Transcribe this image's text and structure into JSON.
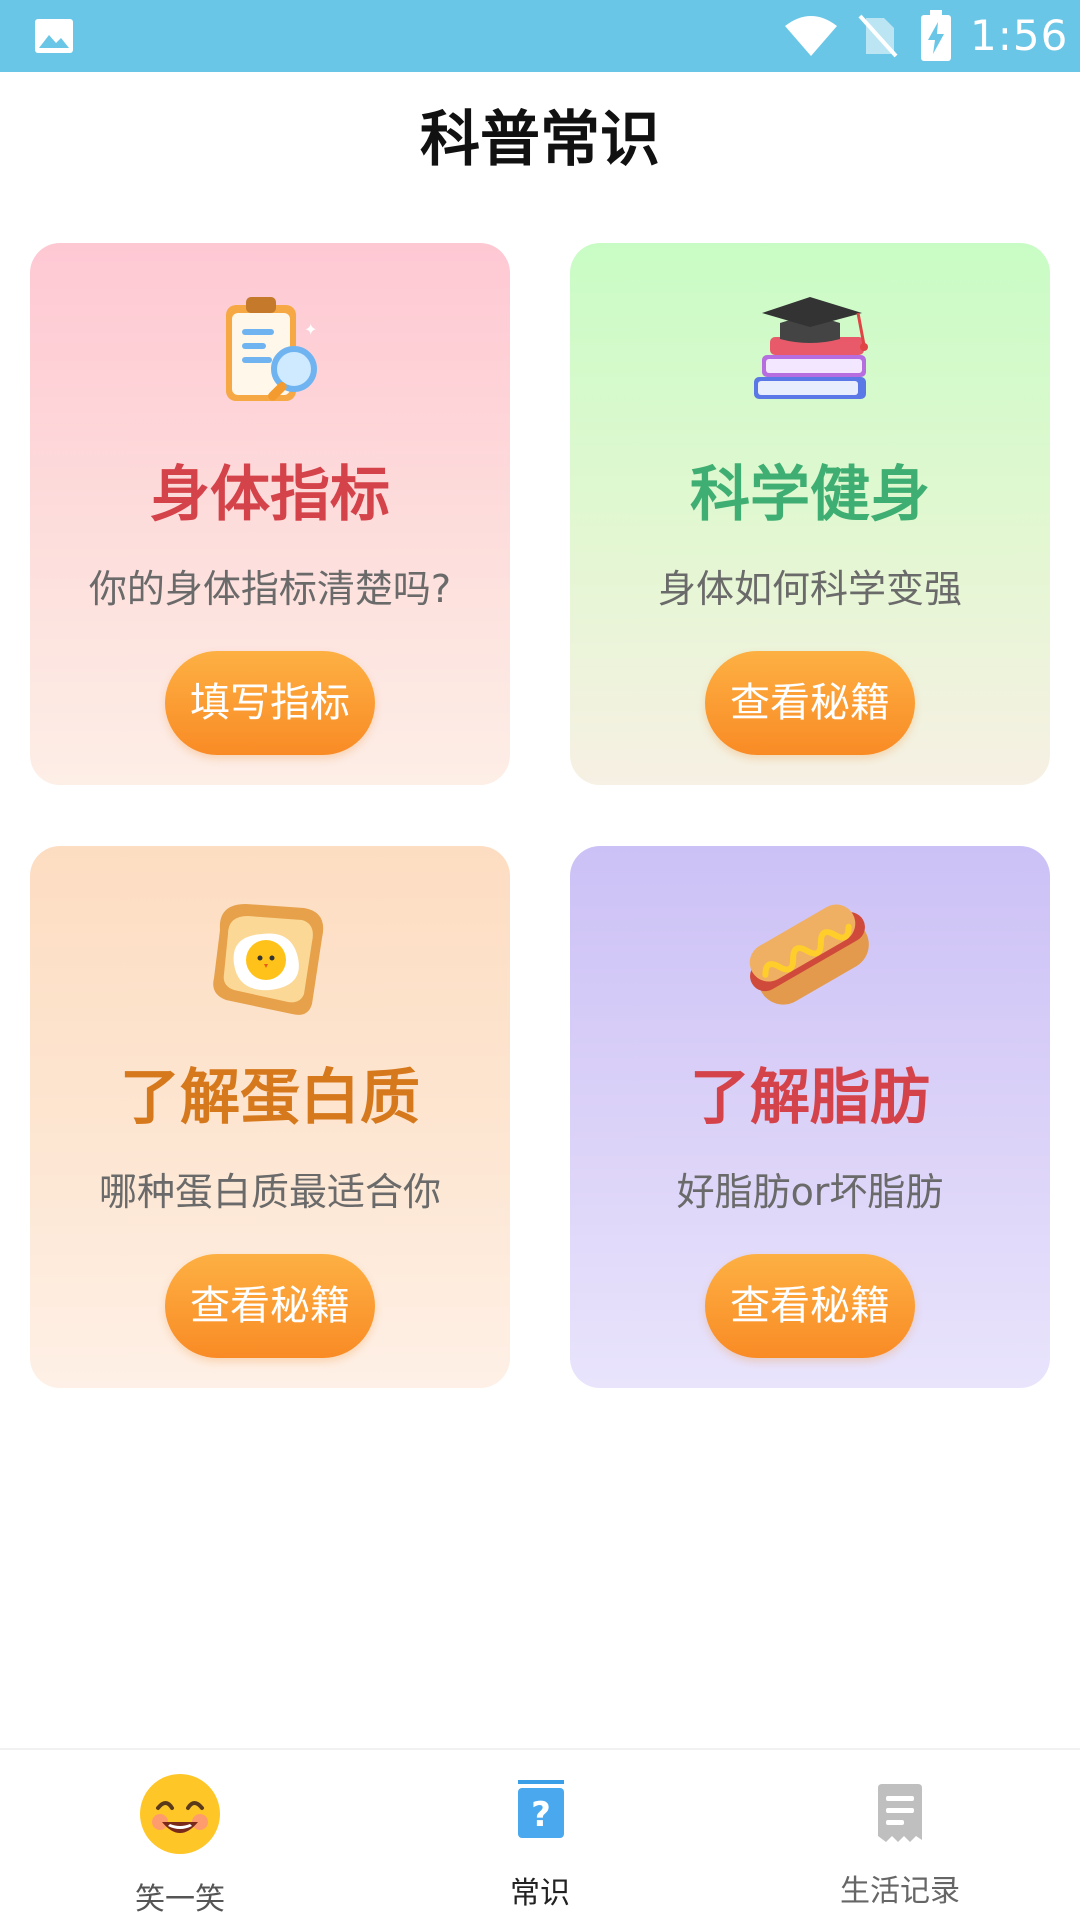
{
  "status_bar": {
    "time": "1:56",
    "icons": [
      "gallery-icon",
      "wifi-icon",
      "no-sim-icon",
      "battery-charging-icon"
    ],
    "background": "#6ac6e6"
  },
  "page": {
    "title": "科普常识"
  },
  "cards": [
    {
      "title": "身体指标",
      "subtitle": "你的身体指标清楚吗?",
      "button": "填写指标",
      "icon": "clipboard-magnifier-icon",
      "title_color": "#d5434a"
    },
    {
      "title": "科学健身",
      "subtitle": "身体如何科学变强",
      "button": "查看秘籍",
      "icon": "books-graduation-cap-icon",
      "title_color": "#3fae72"
    },
    {
      "title": "了解蛋白质",
      "subtitle": "哪种蛋白质最适合你",
      "button": "查看秘籍",
      "icon": "egg-toast-icon",
      "title_color": "#d6781c"
    },
    {
      "title": "了解脂肪",
      "subtitle": "好脂肪or坏脂肪",
      "button": "查看秘籍",
      "icon": "hotdog-icon",
      "title_color": "#d5434a"
    }
  ],
  "bottom_nav": {
    "items": [
      {
        "label": "笑一笑",
        "icon": "smiley-face-icon",
        "active": false
      },
      {
        "label": "常识",
        "icon": "question-book-icon",
        "active": true
      },
      {
        "label": "生活记录",
        "icon": "receipt-document-icon",
        "active": false
      }
    ]
  }
}
